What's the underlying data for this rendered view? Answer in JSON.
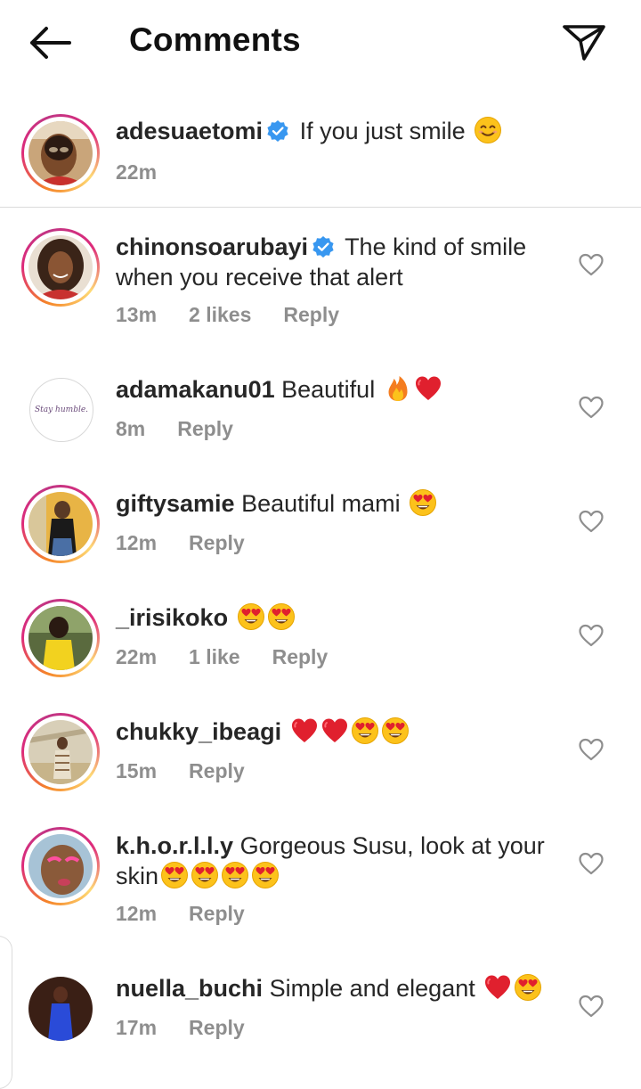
{
  "header": {
    "title": "Comments"
  },
  "icons": {
    "back": "arrow-left-icon",
    "send": "paper-plane-icon",
    "like": "heart-outline-icon",
    "verified": "verified-badge-icon"
  },
  "colors": {
    "verified": "#3897f0",
    "story_ring_start": "#f58529",
    "story_ring_end": "#dd2a7b",
    "meta_gray": "#8e8e8e"
  },
  "caption": {
    "username": "adesuaetomi",
    "text": "If you just smile",
    "emoji": "😊",
    "time": "22m"
  },
  "comments": [
    {
      "username": "chinonsoarubayi",
      "text": "The kind of smile when you receive that alert",
      "time": "13m",
      "likes": "2 likes",
      "reply": "Reply"
    },
    {
      "username": "adamakanu01",
      "text": "Beautiful",
      "time": "8m",
      "reply": "Reply",
      "avatar_text": "Stay humble."
    },
    {
      "username": "giftysamie",
      "text": "Beautiful mami",
      "time": "12m",
      "reply": "Reply"
    },
    {
      "username": "_irisikoko",
      "text": "",
      "time": "22m",
      "likes": "1 like",
      "reply": "Reply"
    },
    {
      "username": "chukky_ibeagi",
      "text": "",
      "time": "15m",
      "reply": "Reply"
    },
    {
      "username": "k.h.o.r.l.l.y",
      "text": "Gorgeous Susu, look at your skin",
      "time": "12m",
      "reply": "Reply"
    },
    {
      "username": "nuella_buchi",
      "text": "Simple and elegant",
      "time": "17m",
      "reply": "Reply"
    }
  ]
}
